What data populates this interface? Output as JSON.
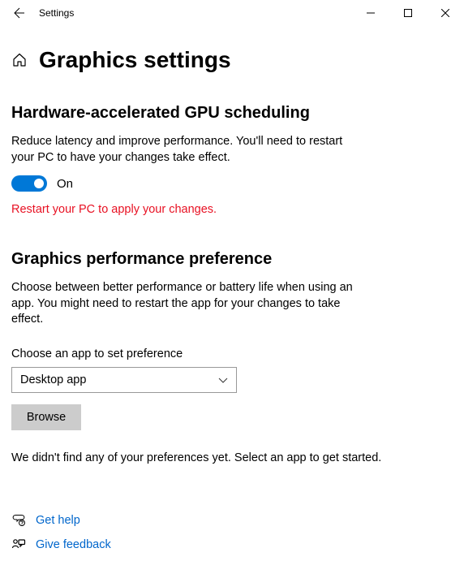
{
  "titlebar": {
    "title": "Settings"
  },
  "page": {
    "title": "Graphics settings"
  },
  "section1": {
    "heading": "Hardware-accelerated GPU scheduling",
    "description": "Reduce latency and improve performance. You'll need to restart your PC to have your changes take effect.",
    "toggle_on": true,
    "toggle_label": "On",
    "restart_msg": "Restart your PC to apply your changes."
  },
  "section2": {
    "heading": "Graphics performance preference",
    "description": "Choose between better performance or battery life when using an app. You might need to restart the app for your changes to take effect.",
    "field_label": "Choose an app to set preference",
    "dropdown_value": "Desktop app",
    "browse_label": "Browse",
    "empty_msg": "We didn't find any of your preferences yet. Select an app to get started."
  },
  "footer": {
    "help_label": "Get help",
    "feedback_label": "Give feedback"
  }
}
